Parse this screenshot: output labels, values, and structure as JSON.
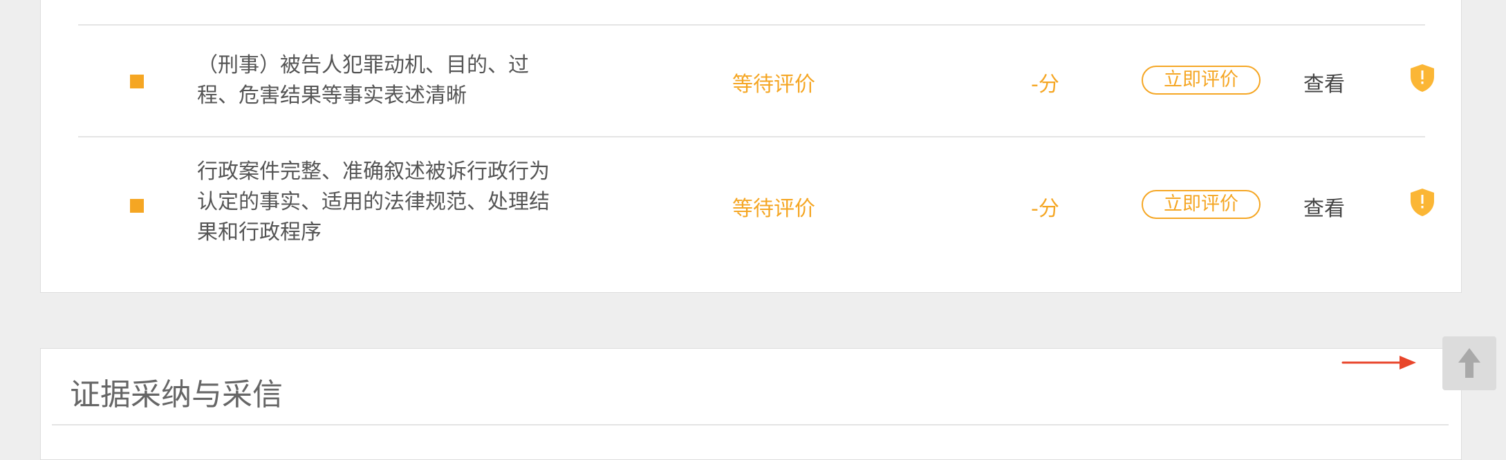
{
  "items": [
    {
      "text_lines": [
        "（刑事）被告人犯罪动机、目的、过",
        "程、危害结果等事实表述清晰"
      ],
      "status": "等待评价",
      "score": "-分",
      "rate_label": "立即评价",
      "view_label": "查看",
      "icon": "shield-warning-icon"
    },
    {
      "text_lines": [
        "行政案件完整、准确叙述被诉行政行为",
        "认定的事实、适用的法律规范、处理结",
        "果和行政程序"
      ],
      "status": "等待评价",
      "score": "-分",
      "rate_label": "立即评价",
      "view_label": "查看",
      "icon": "shield-warning-icon"
    }
  ],
  "section": {
    "title": "证据采纳与采信"
  },
  "back_to_top": {
    "icon": "arrow-up-icon"
  },
  "annotation": {
    "icon": "red-arrow-icon"
  },
  "colors": {
    "accent": "#f5a623",
    "page_bg": "#eeeeee",
    "annotation": "#e8452a"
  }
}
